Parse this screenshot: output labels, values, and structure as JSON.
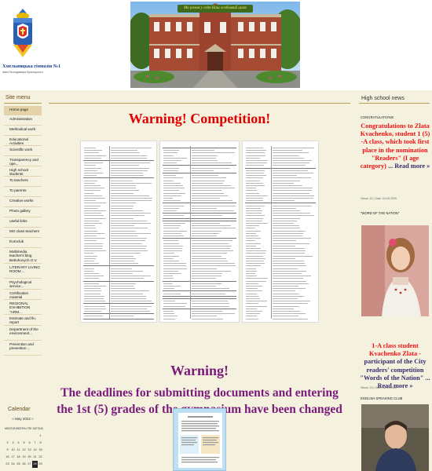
{
  "header": {
    "school_name": "Хмельницька гімназія №1",
    "school_subtitle": "імені Володимира Красицького",
    "banner_text": "Ми разом у світ Наш особливий шлях"
  },
  "sidebar": {
    "title": "Site menu",
    "items": [
      {
        "label": "Home page",
        "active": true
      },
      {
        "label": "Administration"
      },
      {
        "label": "Methodical work"
      },
      {
        "label": "Educational Activities"
      },
      {
        "label": "Scientific work"
      },
      {
        "label": "Transparency and ope..."
      },
      {
        "label": "High school students"
      },
      {
        "label": "To teachers"
      },
      {
        "label": "To parents"
      },
      {
        "label": "Creative works"
      },
      {
        "label": "Photo gallery"
      },
      {
        "label": "useful links"
      },
      {
        "label": "MO class teachers"
      },
      {
        "label": "Euroclub"
      },
      {
        "label": "Multimedia teacher's blog Bebuhovych O.V."
      },
      {
        "label": "LITERARY LIVING ROOM ..."
      },
      {
        "label": "Psychological service..."
      },
      {
        "label": "Certification material"
      },
      {
        "label": "REGIONAL EXHIBITION \"ARM..."
      },
      {
        "label": "Estimate and fin. report"
      },
      {
        "label": "Department of the environment..."
      },
      {
        "label": "Prevention and prevention ..."
      }
    ],
    "calendar_title": "Calendar",
    "calendar_month": "« May 2022 »",
    "calendar_weekdays": [
      "MON",
      "TUE",
      "WED",
      "THU",
      "FRI",
      "SAT",
      "SUN"
    ],
    "calendar_rows": [
      [
        "",
        "",
        "",
        "",
        "",
        "",
        "1"
      ],
      [
        "2",
        "3",
        "4",
        "5",
        "6",
        "7",
        "8"
      ],
      [
        "9",
        "10",
        "11",
        "12",
        "13",
        "14",
        "15"
      ],
      [
        "16",
        "17",
        "18",
        "19",
        "20",
        "21",
        "22"
      ],
      [
        "23",
        "24",
        "25",
        "26",
        "27",
        "28",
        "29"
      ]
    ],
    "calendar_today": "28"
  },
  "main": {
    "warning_title": "Warning! Competition!",
    "warning_heading": "Warning!",
    "warning_text": "The deadlines for submitting documents and entering the 1st (5) grades of the gymnasium have been changed !!!"
  },
  "news": {
    "title": "High school news",
    "items": [
      {
        "heading": "CONGRATULATIONS!",
        "text_red": "Congratulations to Zlata Kvachenko, student 1 (5) -A class, which took first place in the nomination \"Readers\" (I age category)",
        "read_more": "... Read more »",
        "date": "Views: 22 | Date: 24.05.2020"
      },
      {
        "heading": "\"WORD OF THE NATION\"",
        "text_red": "1-A class student Kvachenko Zlata -",
        "text_dark": "participant of the City readers' competition \"Words of the Nation\" ...",
        "read_more": "Read more »",
        "date": "Views: 23 | Date: 24.04.2020"
      },
      {
        "heading": "ENGLISH SPEAKING CLUB"
      }
    ]
  },
  "colors": {
    "background": "#f4f1df",
    "warning_red": "#e00000",
    "warning_purple": "#7a1a7a",
    "news_red": "#ee1111",
    "menu_active": "#e4d3a8"
  }
}
